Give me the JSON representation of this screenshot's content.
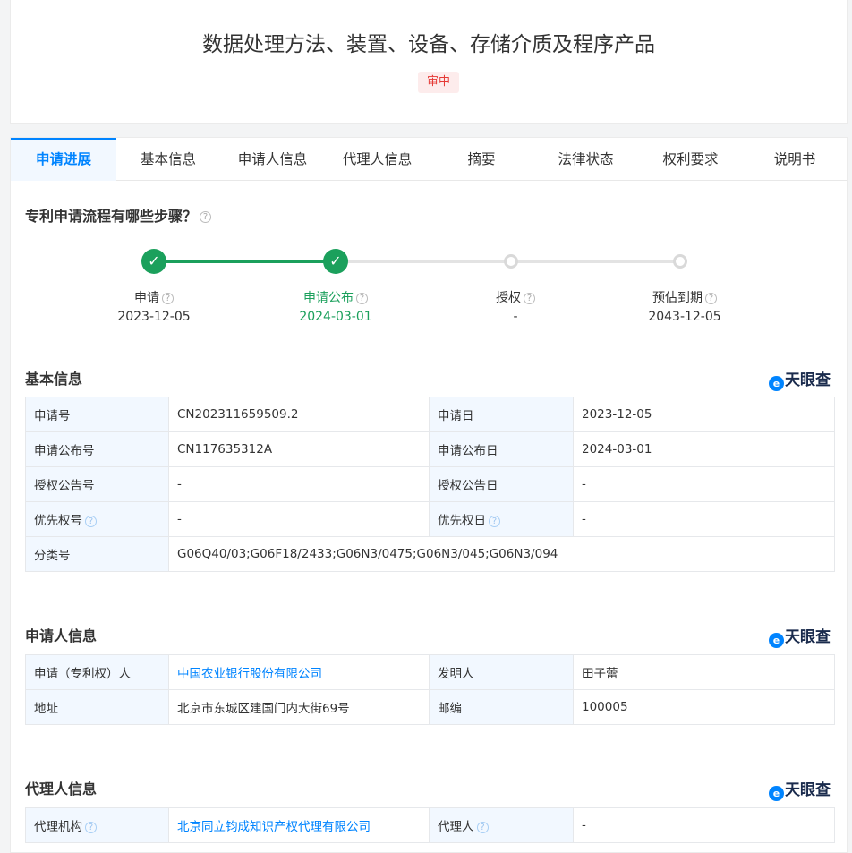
{
  "header": {
    "title": "数据处理方法、装置、设备、存储介质及程序产品",
    "status": "审中"
  },
  "tabs": [
    "申请进展",
    "基本信息",
    "申请人信息",
    "代理人信息",
    "摘要",
    "法律状态",
    "权利要求",
    "说明书"
  ],
  "progress": {
    "title": "专利申请流程有哪些步骤？",
    "steps": [
      {
        "label": "申请",
        "date": "2023-12-05"
      },
      {
        "label": "申请公布",
        "date": "2024-03-01"
      },
      {
        "label": "授权",
        "date": "-"
      },
      {
        "label": "预估到期",
        "date": "2043-12-05"
      }
    ]
  },
  "brand": {
    "name": "天眼查",
    "color": "#0084ff"
  },
  "basic": {
    "title": "基本信息",
    "app_no_k": "申请号",
    "app_no_v": "CN202311659509.2",
    "app_date_k": "申请日",
    "app_date_v": "2023-12-05",
    "pub_no_k": "申请公布号",
    "pub_no_v": "CN117635312A",
    "pub_date_k": "申请公布日",
    "pub_date_v": "2024-03-01",
    "grant_no_k": "授权公告号",
    "grant_no_v": "-",
    "grant_date_k": "授权公告日",
    "grant_date_v": "-",
    "prio_no_k": "优先权号",
    "prio_no_v": "-",
    "prio_date_k": "优先权日",
    "prio_date_v": "-",
    "class_k": "分类号",
    "class_v": "G06Q40/03;G06F18/2433;G06N3/0475;G06N3/045;G06N3/094"
  },
  "applicant": {
    "title": "申请人信息",
    "holder_k": "申请（专利权）人",
    "holder_v": "中国农业银行股份有限公司",
    "inventor_k": "发明人",
    "inventor_v": "田子蕾",
    "addr_k": "地址",
    "addr_v": "北京市东城区建国门内大街69号",
    "zip_k": "邮编",
    "zip_v": "100005"
  },
  "agent": {
    "title": "代理人信息",
    "org_k": "代理机构",
    "org_v": "北京同立钧成知识产权代理有限公司",
    "person_k": "代理人",
    "person_v": "-"
  }
}
